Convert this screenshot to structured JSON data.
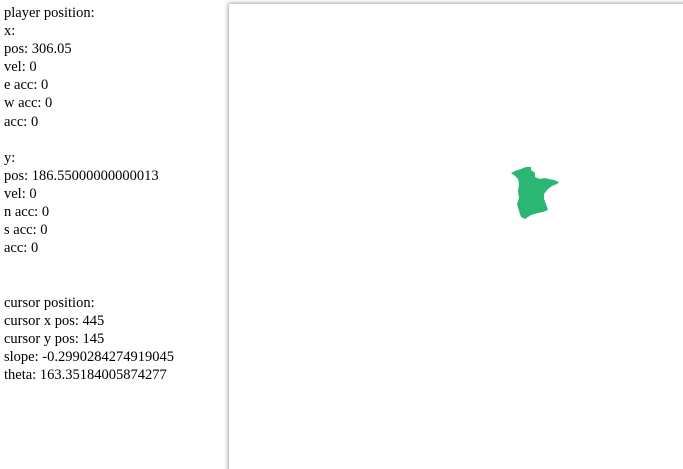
{
  "info": {
    "player_heading": "player position:",
    "x_heading": "x:",
    "x_pos": "pos: 306.05",
    "x_vel": "vel: 0",
    "x_e_acc": "e acc: 0",
    "x_w_acc": "w acc: 0",
    "x_acc": "acc: 0",
    "y_heading": "y:",
    "y_pos": "pos: 186.55000000000013",
    "y_vel": "vel: 0",
    "y_n_acc": "n acc: 0",
    "y_s_acc": "s acc: 0",
    "y_acc": "acc: 0",
    "cursor_heading": "cursor position:",
    "cursor_x": "cursor x pos: 445",
    "cursor_y": "cursor y pos: 145",
    "slope": "slope: -0.2990284274919045",
    "theta": "theta: 163.35184005874277"
  },
  "game": {
    "player_color": "#2bb673",
    "canvas_background": "#ffffff"
  }
}
